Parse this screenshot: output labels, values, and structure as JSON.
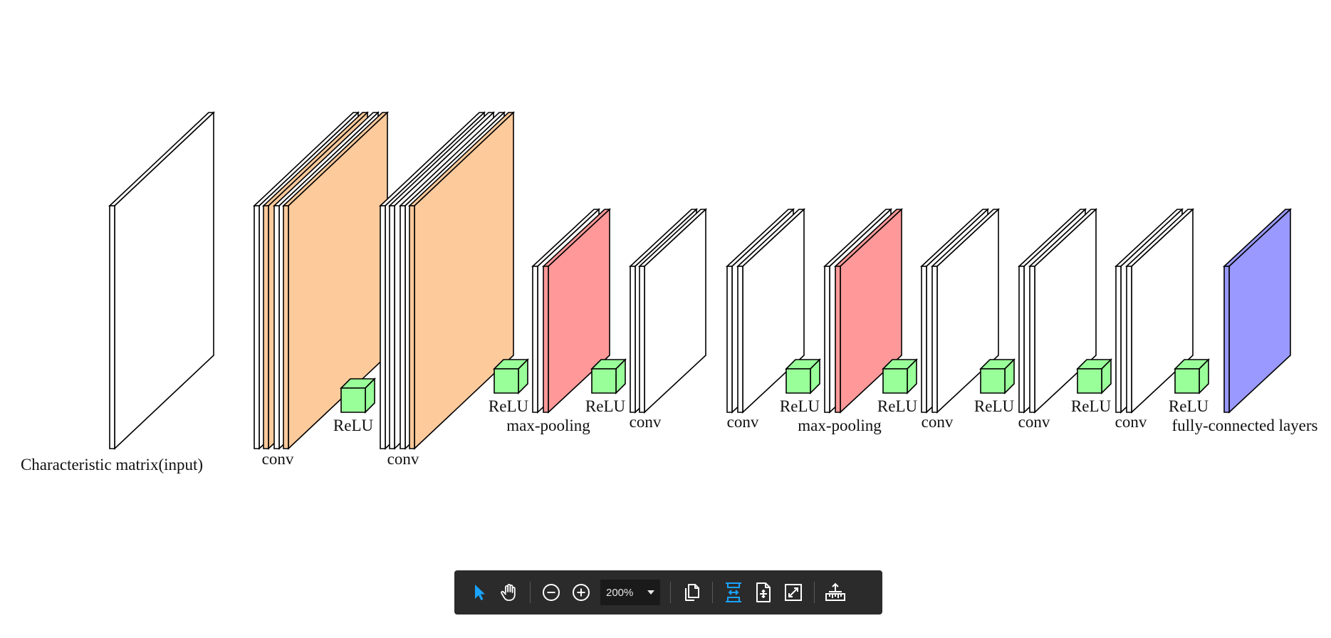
{
  "diagram": {
    "labels": {
      "input": "Characteristic matrix(input)",
      "conv1": "conv",
      "relu1": "ReLU",
      "conv2": "conv",
      "relu2": "ReLU",
      "maxpool1": "max-pooling",
      "relu3": "ReLU",
      "conv3": "conv",
      "conv4": "conv",
      "relu4": "ReLU",
      "maxpool2": "max-pooling",
      "relu5": "ReLU",
      "conv5": "conv",
      "relu6": "ReLU",
      "conv6": "conv",
      "relu7": "ReLU",
      "conv7": "conv",
      "relu8": "ReLU",
      "fc": "fully-connected layers"
    },
    "colors": {
      "input": "#ffffff",
      "conv_large": "#fdca9c",
      "pool": "#ff9999",
      "conv_small": "#ffffff",
      "relu": "#99ff99",
      "fc": "#9999ff",
      "stroke": "#000000"
    }
  },
  "toolbar": {
    "zoom_value": "200%",
    "icons": {
      "select": "select-cursor-icon",
      "hand": "hand-pan-icon",
      "zoom_out": "zoom-out-icon",
      "zoom_in": "zoom-in-icon",
      "zoom_dropdown": "chevron-down-icon",
      "page_view": "page-view-icon",
      "fit_width": "fit-width-icon",
      "fit_page": "fit-page-icon",
      "fullscreen": "fullscreen-icon",
      "measure": "measure-ruler-icon"
    },
    "colors": {
      "background": "#2b2b2b",
      "icon": "#ffffff",
      "active": "#1aa3ff"
    }
  }
}
